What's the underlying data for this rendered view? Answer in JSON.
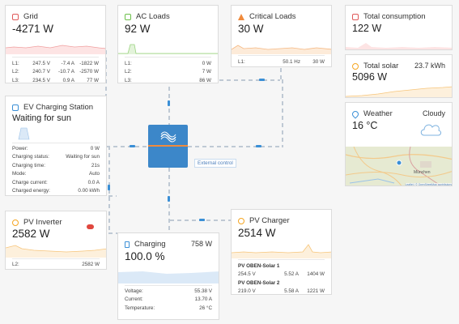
{
  "grid": {
    "title": "Grid",
    "power": "-4271 W",
    "rows": [
      {
        "label": "L1:",
        "v": "247.5 V",
        "a": "-7.4 A",
        "w": "-1822 W"
      },
      {
        "label": "L2:",
        "v": "240.7 V",
        "a": "-10.7 A",
        "w": "-2570 W"
      },
      {
        "label": "L3:",
        "v": "234.5 V",
        "a": "0.9 A",
        "w": "77 W"
      }
    ]
  },
  "ac_loads": {
    "title": "AC Loads",
    "power": "92 W",
    "rows": [
      {
        "label": "L1:",
        "w": "0 W"
      },
      {
        "label": "L2:",
        "w": "7 W"
      },
      {
        "label": "L3:",
        "w": "86 W"
      }
    ]
  },
  "critical_loads": {
    "title": "Critical Loads",
    "power": "30 W",
    "rows": [
      {
        "label": "L1:",
        "hz": "50.1 Hz",
        "w": "30 W"
      }
    ]
  },
  "total_consumption": {
    "title": "Total consumption",
    "power": "122 W"
  },
  "total_solar": {
    "title": "Total solar",
    "energy": "23.7 kWh",
    "power": "5096 W"
  },
  "weather": {
    "title": "Weather",
    "condition": "Cloudy",
    "temp": "16 °C",
    "map_label_city": "München",
    "map_attrib": "Leaflet | © OpenStreetMap contributors"
  },
  "ev": {
    "title": "EV Charging Station",
    "status": "Waiting for sun",
    "rows": [
      {
        "k": "Power:",
        "v": "0 W"
      },
      {
        "k": "Charging status:",
        "v": "Waiting for sun"
      },
      {
        "k": "Charging time:",
        "v": "21s"
      },
      {
        "k": "Mode:",
        "v": "Auto"
      },
      {
        "k": "Charge current:",
        "v": "0.0 A"
      },
      {
        "k": "Charged energy:",
        "v": "0.00 kWh"
      }
    ]
  },
  "inverter": {
    "tooltip": "External control"
  },
  "pv_inverter": {
    "title": "PV Inverter",
    "power": "2582 W",
    "rows": [
      {
        "k": "L2:",
        "v": "2582 W"
      }
    ]
  },
  "charging": {
    "title": "Charging",
    "power": "758 W",
    "soc": "100.0 %",
    "rows": [
      {
        "k": "Voltage:",
        "v": "55.38 V"
      },
      {
        "k": "Current:",
        "v": "13.70 A"
      },
      {
        "k": "Temperature:",
        "v": "26 °C"
      }
    ]
  },
  "pv_charger": {
    "title": "PV Charger",
    "power": "2514 W",
    "chargers": [
      {
        "name": "PV OBEN-Solar 1",
        "v": "254.5 V",
        "a": "5.52 A",
        "w": "1404 W"
      },
      {
        "name": "PV OBEN-Solar 2",
        "v": "219.0 V",
        "a": "5.58 A",
        "w": "1221 W"
      }
    ]
  },
  "colors": {
    "grid": "#e05a5a",
    "ac": "#6cc04a",
    "critical": "#f08a3c",
    "solar": "#f5a623",
    "accent": "#3a8fd6"
  }
}
